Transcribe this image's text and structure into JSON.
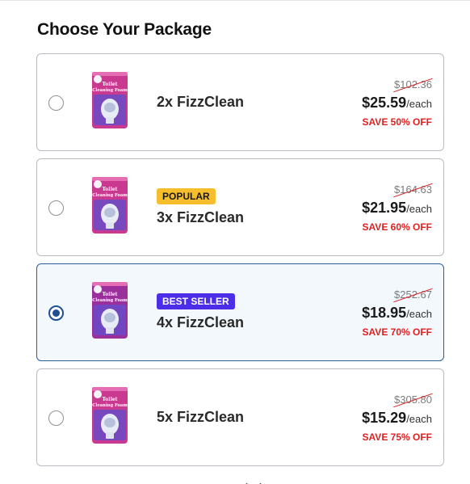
{
  "heading": "Choose Your Package",
  "product_label_text": [
    "Toilet",
    "Cleaning Foam"
  ],
  "packages": [
    {
      "name": "2x FizzClean",
      "badge": "",
      "original_price": "$102.36",
      "price": "$25.59",
      "unit": "/each",
      "save": "SAVE 50% OFF",
      "selected": false,
      "pack_color": "#c8398f"
    },
    {
      "name": "3x FizzClean",
      "badge": "POPULAR",
      "badge_style": "popular",
      "original_price": "$164.63",
      "price": "$21.95",
      "unit": "/each",
      "save": "SAVE 60% OFF",
      "selected": false,
      "pack_color": "#c8398f"
    },
    {
      "name": "4x FizzClean",
      "badge": "BEST SELLER",
      "badge_style": "best",
      "original_price": "$252.67",
      "price": "$18.95",
      "unit": "/each",
      "save": "SAVE 70% OFF",
      "selected": true,
      "pack_color": "#9b2f9c"
    },
    {
      "name": "5x FizzClean",
      "badge": "",
      "original_price": "$305.80",
      "price": "$15.29",
      "unit": "/each",
      "save": "SAVE 75% OFF",
      "selected": false,
      "pack_color": "#c8398f"
    }
  ],
  "colors": {
    "accent_blue": "#1f4f93",
    "selected_bg": "#f3f8fd",
    "popular_badge": "#f6be2c",
    "best_badge": "#4d2ee8",
    "save_red": "#e01f1f"
  }
}
